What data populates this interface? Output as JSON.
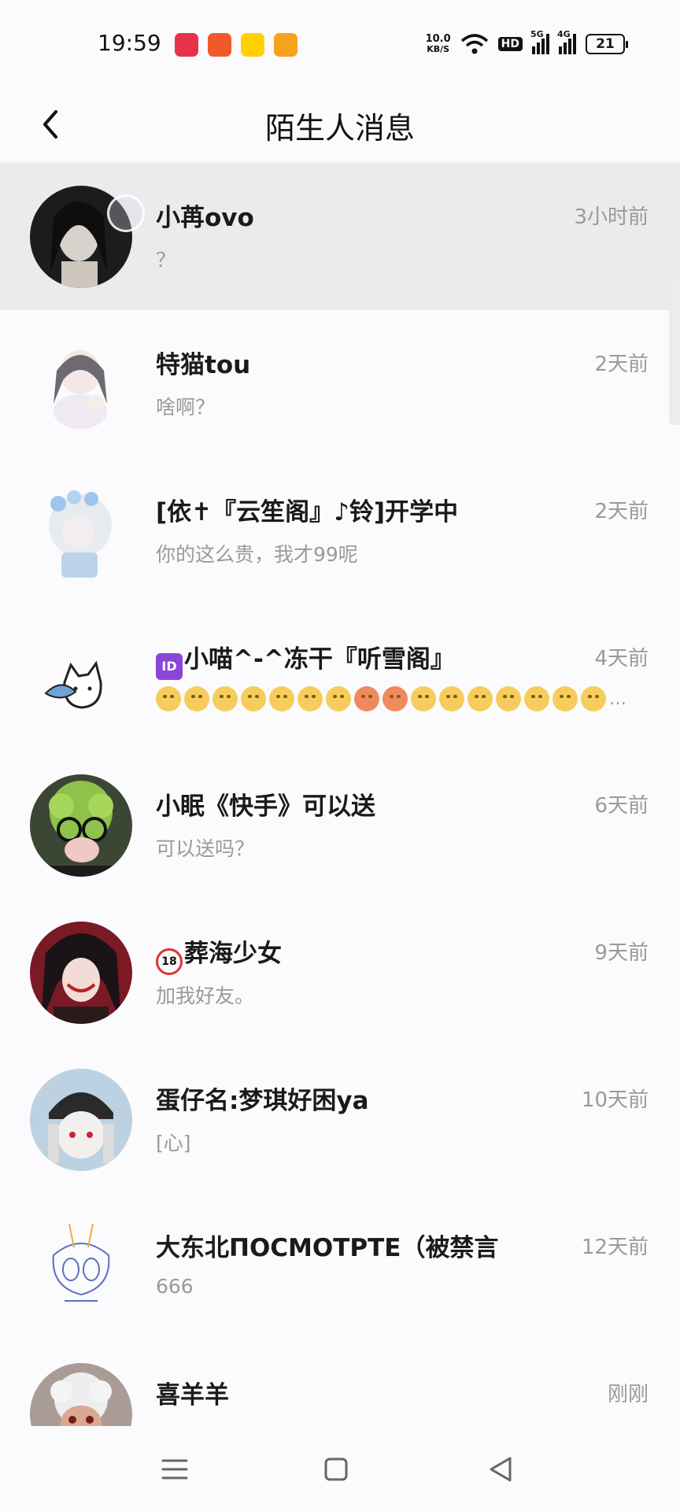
{
  "status_bar": {
    "time": "19:59",
    "net_speed_value": "10.0",
    "net_speed_unit": "KB/S",
    "hd_label": "HD",
    "signal_1_label": "5G",
    "signal_2_label": "4G",
    "battery_level": "21",
    "app_icons": [
      {
        "name": "video-app-icon",
        "color": "#e6334a"
      },
      {
        "name": "kuaishou-app-icon",
        "color": "#f05a28"
      },
      {
        "name": "meituan-app-icon",
        "color": "#ffd100",
        "label": "美团"
      },
      {
        "name": "media-app-icon",
        "color": "#f7a21b"
      }
    ]
  },
  "header": {
    "title": "陌生人消息"
  },
  "conversations": [
    {
      "name": "小苒ovo",
      "time": "3小时前",
      "preview": "？",
      "avatar_color": "#2b2b2b"
    },
    {
      "name": "特猫tou",
      "time": "2天前",
      "preview": "啥啊？",
      "avatar_color": "#f1eef0"
    },
    {
      "name": "[依✝『云笙阁』♪铃]开学中",
      "time": "2天前",
      "preview": "你的这么贵，我才99呢",
      "avatar_color": "#d9e4ef"
    },
    {
      "name": "小喵^-^冻干『听雪阁』",
      "time": "4天前",
      "preview": "",
      "has_id_tag": true,
      "tag_text": "ID",
      "emoji_count": 16,
      "avatar_color": "#ffffff"
    },
    {
      "name": "小眠《快手》可以送",
      "time": "6天前",
      "preview": "可以送吗？",
      "avatar_color": "#6a7a45"
    },
    {
      "name": "葬海少女",
      "time": "9天前",
      "preview": "加我好友。",
      "has_18_tag": true,
      "tag_text": "18",
      "avatar_color": "#5a2a2e"
    },
    {
      "name": "蛋仔名:梦琪好困ya",
      "time": "10天前",
      "preview": "[心]",
      "avatar_color": "#c4d6e3"
    },
    {
      "name": "大东北ПОСМОТРТЕ（被禁言",
      "time": "12天前",
      "preview": "666",
      "avatar_color": "#ffffff"
    },
    {
      "name": "喜羊羊",
      "time": "刚刚",
      "preview": "",
      "avatar_color": "#a89a95"
    }
  ],
  "nav_bar": {
    "menu_icon": "menu-icon",
    "home_icon": "home-icon",
    "back_icon": "back-triangle-icon"
  }
}
